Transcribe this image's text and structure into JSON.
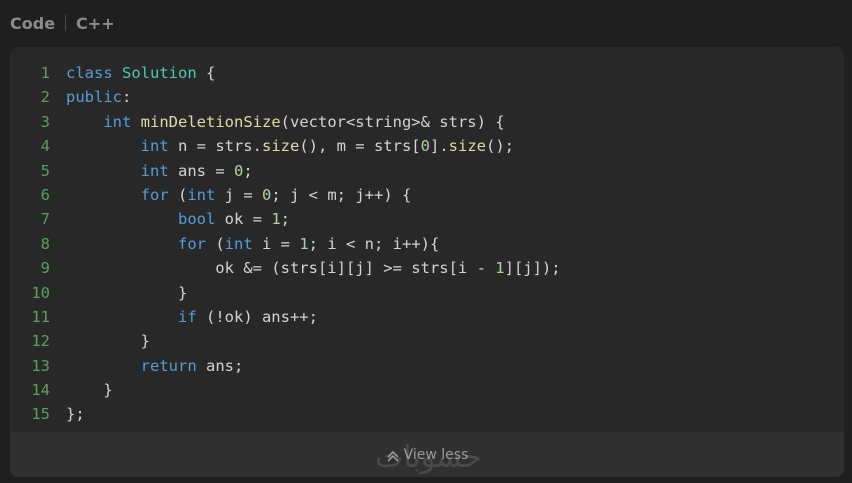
{
  "tabs": [
    {
      "label": "Code"
    },
    {
      "label": "C++"
    }
  ],
  "code": {
    "lines": [
      {
        "n": "1",
        "tokens": [
          {
            "t": "class ",
            "c": "kw"
          },
          {
            "t": "Solution",
            "c": "ty"
          },
          {
            "t": " {",
            "c": "txt"
          }
        ]
      },
      {
        "n": "2",
        "tokens": [
          {
            "t": "public",
            "c": "kw"
          },
          {
            "t": ":",
            "c": "txt"
          }
        ]
      },
      {
        "n": "3",
        "tokens": [
          {
            "t": "    ",
            "c": "txt"
          },
          {
            "t": "int",
            "c": "kw"
          },
          {
            "t": " ",
            "c": "txt"
          },
          {
            "t": "minDeletionSize",
            "c": "fn"
          },
          {
            "t": "(vector<string>& strs) {",
            "c": "txt"
          }
        ]
      },
      {
        "n": "4",
        "tokens": [
          {
            "t": "        ",
            "c": "txt"
          },
          {
            "t": "int",
            "c": "kw"
          },
          {
            "t": " n = strs.",
            "c": "txt"
          },
          {
            "t": "size",
            "c": "fn"
          },
          {
            "t": "(), m = strs[",
            "c": "txt"
          },
          {
            "t": "0",
            "c": "nu"
          },
          {
            "t": "].",
            "c": "txt"
          },
          {
            "t": "size",
            "c": "fn"
          },
          {
            "t": "();",
            "c": "txt"
          }
        ]
      },
      {
        "n": "5",
        "tokens": [
          {
            "t": "        ",
            "c": "txt"
          },
          {
            "t": "int",
            "c": "kw"
          },
          {
            "t": " ans = ",
            "c": "txt"
          },
          {
            "t": "0",
            "c": "nu"
          },
          {
            "t": ";",
            "c": "txt"
          }
        ]
      },
      {
        "n": "6",
        "tokens": [
          {
            "t": "        ",
            "c": "txt"
          },
          {
            "t": "for",
            "c": "kw"
          },
          {
            "t": " (",
            "c": "txt"
          },
          {
            "t": "int",
            "c": "kw"
          },
          {
            "t": " j = ",
            "c": "txt"
          },
          {
            "t": "0",
            "c": "nu"
          },
          {
            "t": "; j < m; j++) {",
            "c": "txt"
          }
        ]
      },
      {
        "n": "7",
        "tokens": [
          {
            "t": "            ",
            "c": "txt"
          },
          {
            "t": "bool",
            "c": "kw"
          },
          {
            "t": " ok = ",
            "c": "txt"
          },
          {
            "t": "1",
            "c": "nu"
          },
          {
            "t": ";",
            "c": "txt"
          }
        ]
      },
      {
        "n": "8",
        "tokens": [
          {
            "t": "            ",
            "c": "txt"
          },
          {
            "t": "for",
            "c": "kw"
          },
          {
            "t": " (",
            "c": "txt"
          },
          {
            "t": "int",
            "c": "kw"
          },
          {
            "t": " i = ",
            "c": "txt"
          },
          {
            "t": "1",
            "c": "nu"
          },
          {
            "t": "; i < n; i++){",
            "c": "txt"
          }
        ]
      },
      {
        "n": "9",
        "tokens": [
          {
            "t": "                ok &= (strs[i][j] >= strs[i - ",
            "c": "txt"
          },
          {
            "t": "1",
            "c": "nu"
          },
          {
            "t": "][j]);",
            "c": "txt"
          }
        ]
      },
      {
        "n": "10",
        "tokens": [
          {
            "t": "            }",
            "c": "txt"
          }
        ]
      },
      {
        "n": "11",
        "tokens": [
          {
            "t": "            ",
            "c": "txt"
          },
          {
            "t": "if",
            "c": "kw"
          },
          {
            "t": " (!ok) ans++;",
            "c": "txt"
          }
        ]
      },
      {
        "n": "12",
        "tokens": [
          {
            "t": "        }",
            "c": "txt"
          }
        ]
      },
      {
        "n": "13",
        "tokens": [
          {
            "t": "        ",
            "c": "txt"
          },
          {
            "t": "return",
            "c": "kw"
          },
          {
            "t": " ans;",
            "c": "txt"
          }
        ]
      },
      {
        "n": "14",
        "tokens": [
          {
            "t": "    }",
            "c": "txt"
          }
        ]
      },
      {
        "n": "15",
        "tokens": [
          {
            "t": "};",
            "c": "txt"
          }
        ]
      }
    ]
  },
  "footer": {
    "label": "View less",
    "icon": "chevron-up-icon"
  },
  "watermark": {
    "text": "حسوبات"
  }
}
